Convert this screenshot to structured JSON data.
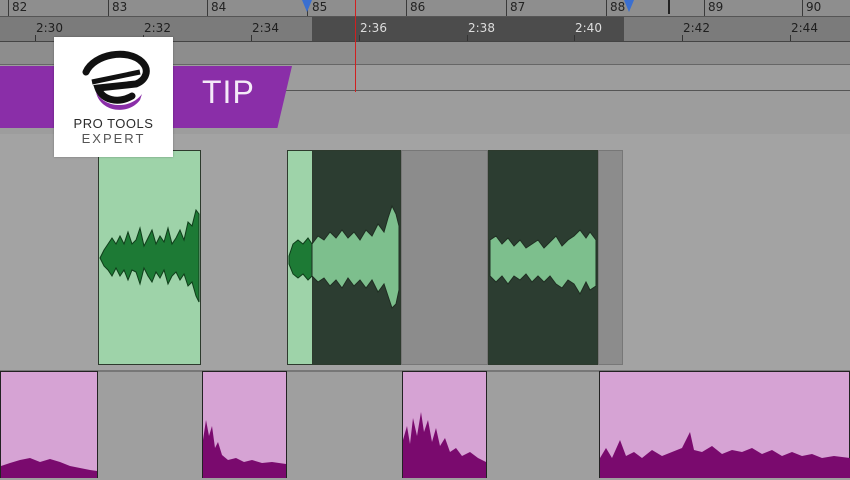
{
  "ruler": {
    "bars": [
      {
        "label": "82"
      },
      {
        "label": "83"
      },
      {
        "label": "84"
      },
      {
        "label": "85"
      },
      {
        "label": "86"
      },
      {
        "label": "87"
      },
      {
        "label": "88"
      },
      {
        "label": "89"
      },
      {
        "label": "90"
      }
    ],
    "times": [
      {
        "label": "2:30"
      },
      {
        "label": "2:32"
      },
      {
        "label": "2:34"
      },
      {
        "label": "2:36"
      },
      {
        "label": "2:38"
      },
      {
        "label": "2:40"
      },
      {
        "label": "2:42"
      },
      {
        "label": "2:44"
      }
    ]
  },
  "banner": {
    "tip": "TIP"
  },
  "logo": {
    "line1": "PRO TOOLS",
    "line2": "EXPERT"
  },
  "colors": {
    "accent_purple": "#8a2ea8",
    "clip_green_light": "#9ed3a9",
    "clip_green_dark": "#2c3d31",
    "wave_green": "#1d7a35",
    "clip_pink": "#d6a3d4",
    "wave_purple": "#7a0a6e",
    "playhead": "#d02020",
    "marker": "#3a6fd0"
  }
}
